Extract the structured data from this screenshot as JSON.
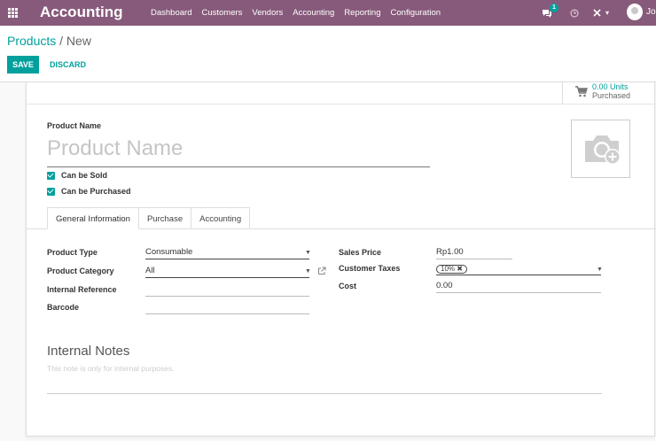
{
  "navbar": {
    "app_title": "Accounting",
    "menu": [
      "Dashboard",
      "Customers",
      "Vendors",
      "Accounting",
      "Reporting",
      "Configuration"
    ],
    "chat_count": "1",
    "user_name": "Jo",
    "color": "#875a7b"
  },
  "control": {
    "breadcrumb_parent": "Products",
    "breadcrumb_sep": " / ",
    "breadcrumb_current": "New",
    "save_label": "SAVE",
    "discard_label": "DISCARD"
  },
  "stat": {
    "value": "0.00 Units",
    "label": "Purchased",
    "icon": "cart-icon"
  },
  "form": {
    "product_name_label": "Product Name",
    "product_name_placeholder": "Product Name",
    "can_be_sold": "Can be Sold",
    "can_be_purchased": "Can be Purchased",
    "image_icon": "camera-plus-icon"
  },
  "tabs": [
    "General Information",
    "Purchase",
    "Accounting"
  ],
  "general": {
    "product_type_label": "Product Type",
    "product_type_value": "Consumable",
    "product_category_label": "Product Category",
    "product_category_value": "All",
    "internal_reference_label": "Internal Reference",
    "internal_reference_value": "",
    "barcode_label": "Barcode",
    "barcode_value": "",
    "sales_price_label": "Sales Price",
    "sales_price_value": "Rp1.00",
    "customer_taxes_label": "Customer Taxes",
    "customer_tax_tag": "10%",
    "cost_label": "Cost",
    "cost_value": "0.00"
  },
  "notes": {
    "title": "Internal Notes",
    "placeholder": "This note is only for internal purposes."
  },
  "accent": "#00a09d"
}
